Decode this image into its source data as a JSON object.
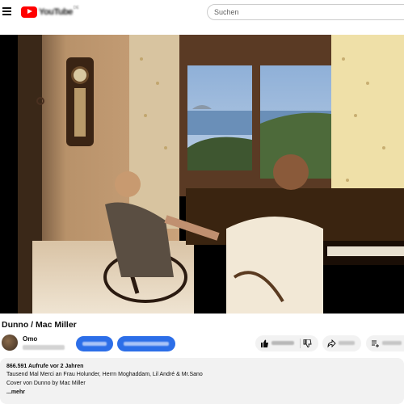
{
  "header": {
    "logo_text": "YouTube",
    "logo_country": "DE",
    "search_placeholder": "Suchen"
  },
  "video": {
    "title": "Dunno / Mac Miller",
    "channel_name": "Omo"
  },
  "description": {
    "stats": "866.591 Aufrufe  vor 2 Jahren",
    "line1": "Tausend Mal Merci an Frau Holunder, Herrn Moghaddam, Lil André & Mr.Sano",
    "line2": "Cover von Dunno by Mac Miller",
    "more": "...mehr"
  },
  "colors": {
    "brand_red": "#ff0000",
    "accent_blue": "#2c6ee8",
    "pill_bg": "#f2f2f2"
  },
  "icons": {
    "menu": "menu-icon",
    "like": "thumbs-up-icon",
    "dislike": "thumbs-down-icon",
    "share": "share-icon",
    "save": "save-icon"
  }
}
